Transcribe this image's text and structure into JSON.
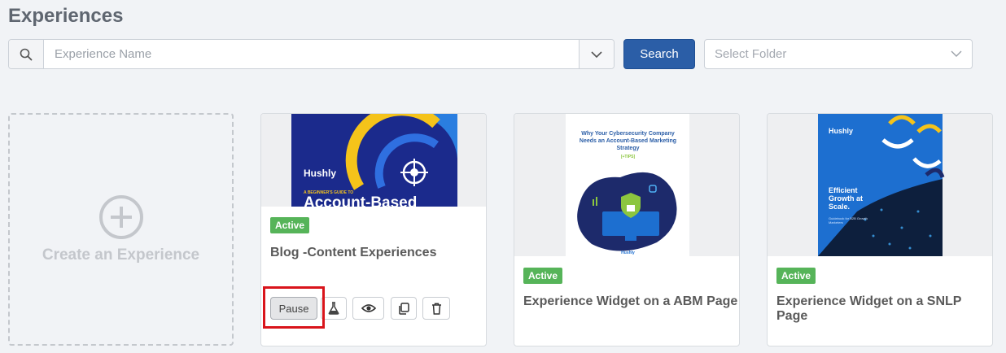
{
  "page": {
    "title": "Experiences"
  },
  "search": {
    "placeholder": "Experience Name",
    "button_label": "Search"
  },
  "folder_select": {
    "placeholder": "Select Folder"
  },
  "create_card": {
    "label": "Create an Experience"
  },
  "cards": [
    {
      "status": "Active",
      "title": "Blog -Content Experiences",
      "thumb_text": [
        "Hushly",
        "A BEGINNER'S GUIDE TO",
        "Account-Based"
      ]
    },
    {
      "status": "Active",
      "title": "Experience Widget on a ABM Page",
      "thumb_text": [
        "Why Your Cybersecurity Company Needs an Account-Based Marketing Strategy",
        "[+TIPS]",
        "Hushly"
      ]
    },
    {
      "status": "Active",
      "title": "Experience Widget on a SNLP Page",
      "thumb_text": [
        "Hushly",
        "Efficient Growth at Scale.",
        "Guidebook for B2B Growth Marketers"
      ]
    }
  ],
  "actions": {
    "pause_label": "Pause"
  },
  "colors": {
    "primary": "#2b5ea7",
    "active_badge": "#56b459",
    "highlight": "#d9141b"
  }
}
